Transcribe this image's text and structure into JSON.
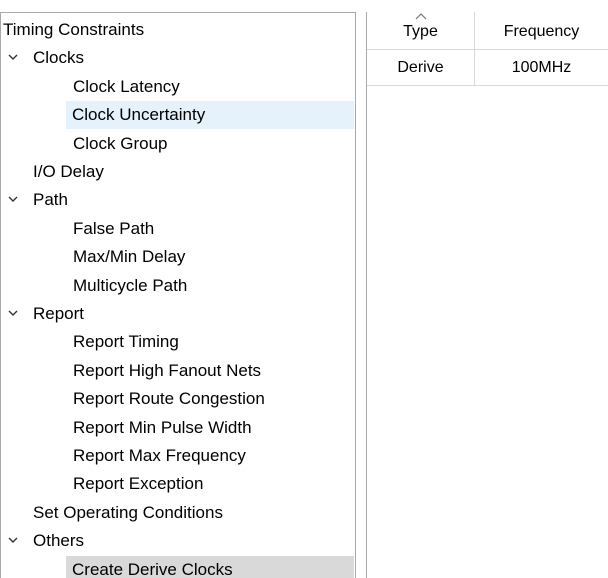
{
  "tree": {
    "root_label": "Timing Constraints",
    "items": [
      {
        "label": "Clocks",
        "level": 1,
        "expanded": true
      },
      {
        "label": "Clock Latency",
        "level": 2
      },
      {
        "label": "Clock Uncertainty",
        "level": 2,
        "selected": true
      },
      {
        "label": "Clock Group",
        "level": 2
      },
      {
        "label": "I/O Delay",
        "level": 1
      },
      {
        "label": "Path",
        "level": 1,
        "expanded": true
      },
      {
        "label": "False Path",
        "level": 2
      },
      {
        "label": "Max/Min Delay",
        "level": 2
      },
      {
        "label": "Multicycle Path",
        "level": 2
      },
      {
        "label": "Report",
        "level": 1,
        "expanded": true
      },
      {
        "label": "Report Timing",
        "level": 2
      },
      {
        "label": "Report High Fanout Nets",
        "level": 2
      },
      {
        "label": "Report Route Congestion",
        "level": 2
      },
      {
        "label": "Report Min Pulse Width",
        "level": 2
      },
      {
        "label": "Report Max Frequency",
        "level": 2
      },
      {
        "label": "Report Exception",
        "level": 2
      },
      {
        "label": "Set Operating Conditions",
        "level": 1
      },
      {
        "label": "Others",
        "level": 1,
        "expanded": true
      },
      {
        "label": "Create Derive Clocks",
        "level": 2,
        "highlighted": true
      }
    ]
  },
  "table": {
    "columns": [
      {
        "label": "Type",
        "sort_icon": "sort-up-icon"
      },
      {
        "label": "Frequency"
      }
    ],
    "rows": [
      [
        "Derive",
        "100MHz"
      ]
    ]
  },
  "colors": {
    "selected_row": "#e5f1fb",
    "highlighted_row": "#d9d9d9",
    "border": "#a9a9a9"
  }
}
